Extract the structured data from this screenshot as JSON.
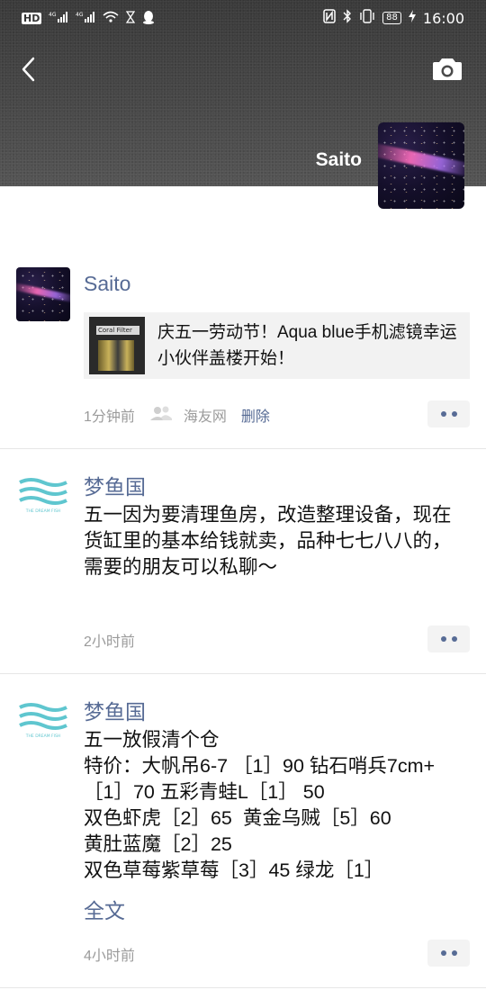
{
  "status_bar": {
    "left_items": [
      "HD",
      "4G",
      "4G"
    ],
    "time": "16:00",
    "battery": "88"
  },
  "header": {
    "back_icon": "chevron-left-icon",
    "camera_icon": "camera-icon",
    "cover_name": "Saito"
  },
  "posts": [
    {
      "name": "Saito",
      "link_card": {
        "thumb_label": "Coral Filter",
        "text": "庆五一劳动节！Aqua blue手机滤镜幸运小伙伴盖楼开始！"
      },
      "time": "1分钟前",
      "source": "海友网",
      "delete_label": "删除"
    },
    {
      "name": "梦鱼国",
      "avatar_caption": "THE DREAM FISH",
      "text": "五一因为要清理鱼房，改造整理设备，现在货缸里的基本给钱就卖，品种七七八八的，需要的朋友可以私聊～",
      "time": "2小时前"
    },
    {
      "name": "梦鱼国",
      "avatar_caption": "THE DREAM FISH",
      "text": "五一放假清个仓\n特价：大帆吊6-7 ［1］90 钻石哨兵7cm+ ［1］70 五彩青蛙L［1］ 50\n双色虾虎［2］65  黄金乌贼［5］60\n黄肚蓝魔［2］25\n双色草莓紫草莓［3］45 绿龙［1］",
      "full_text_label": "全文",
      "time": "4小时前"
    }
  ]
}
